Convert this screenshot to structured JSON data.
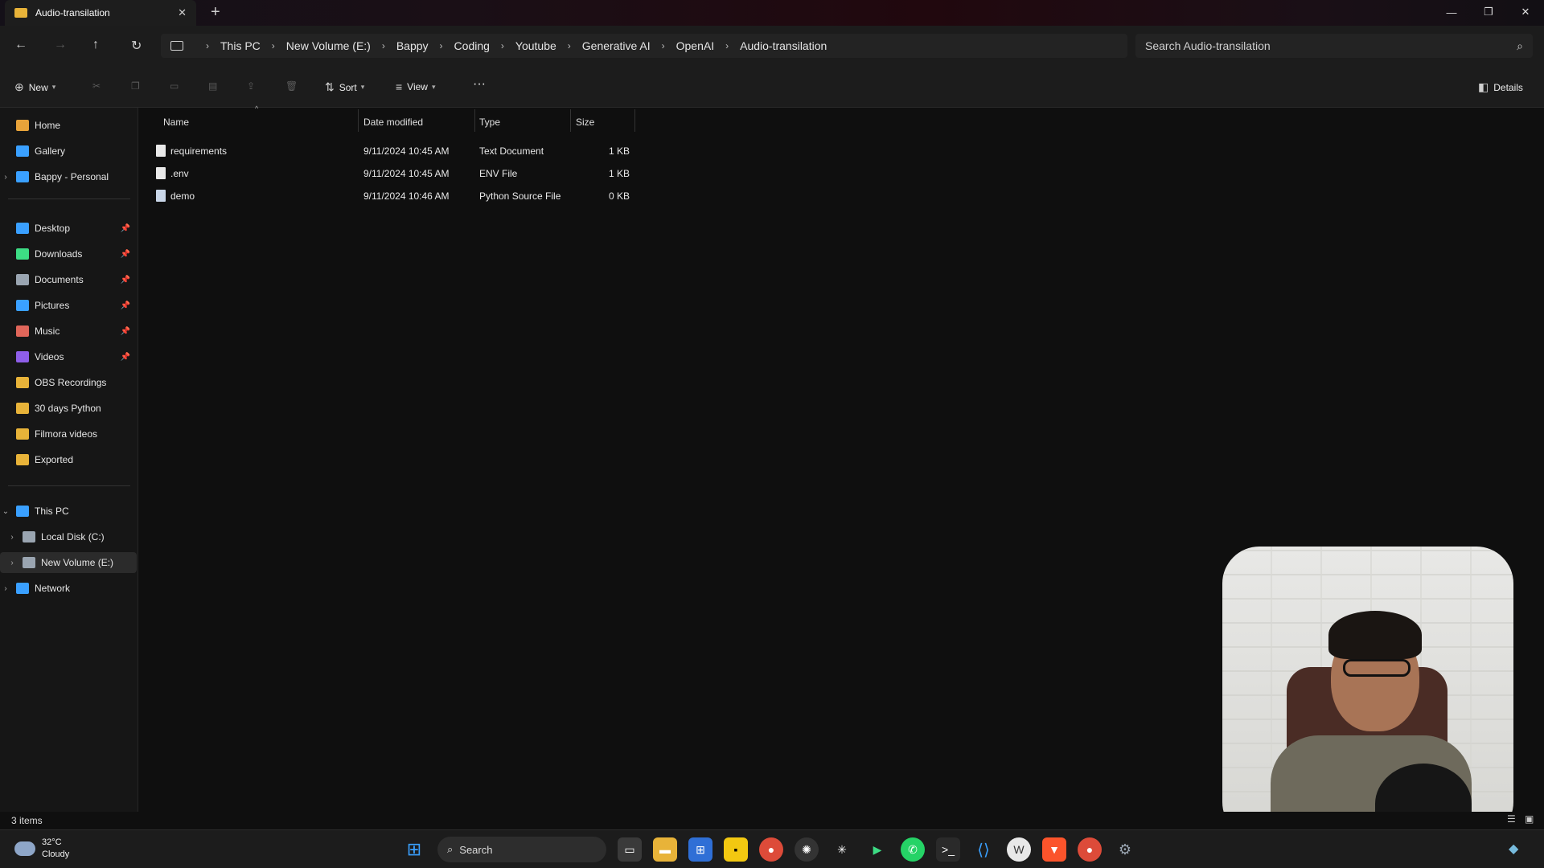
{
  "window": {
    "tab_title": "Audio-transilation",
    "new_tab": "+",
    "minimize": "—",
    "maximize": "❐",
    "close": "✕"
  },
  "address": {
    "crumbs": [
      "This PC",
      "New Volume (E:)",
      "Bappy",
      "Coding",
      "Youtube",
      "Generative AI",
      "OpenAI",
      "Audio-transilation"
    ],
    "search_placeholder": "Search Audio-transilation"
  },
  "toolbar": {
    "new_label": "New",
    "sort_label": "Sort",
    "view_label": "View",
    "more_label": "···",
    "details_label": "Details"
  },
  "sidebar": {
    "quick": [
      {
        "label": "Home",
        "icon": "home-icon"
      },
      {
        "label": "Gallery",
        "icon": "gallery-icon"
      },
      {
        "label": "Bappy - Personal",
        "icon": "cloud-icon"
      }
    ],
    "pinned": [
      {
        "label": "Desktop",
        "icon": "desktop-icon"
      },
      {
        "label": "Downloads",
        "icon": "download-icon"
      },
      {
        "label": "Documents",
        "icon": "document-icon"
      },
      {
        "label": "Pictures",
        "icon": "pictures-icon"
      },
      {
        "label": "Music",
        "icon": "music-icon"
      },
      {
        "label": "Videos",
        "icon": "videos-icon"
      },
      {
        "label": "OBS Recordings",
        "icon": "folder-icon"
      },
      {
        "label": "30 days Python",
        "icon": "folder-icon"
      },
      {
        "label": "Filmora videos",
        "icon": "folder-icon"
      },
      {
        "label": "Exported",
        "icon": "folder-icon"
      }
    ],
    "tree": [
      {
        "label": "This PC",
        "icon": "pc-icon"
      },
      {
        "label": "Local Disk (C:)",
        "icon": "disk-icon"
      },
      {
        "label": "New Volume (E:)",
        "icon": "drive-icon"
      },
      {
        "label": "Network",
        "icon": "network-icon"
      }
    ]
  },
  "columns": [
    "Name",
    "Date modified",
    "Type",
    "Size"
  ],
  "files": [
    {
      "name": "requirements",
      "date": "9/11/2024 10:45 AM",
      "type": "Text Document",
      "size": "1 KB"
    },
    {
      "name": ".env",
      "date": "9/11/2024 10:45 AM",
      "type": "ENV File",
      "size": "1 KB"
    },
    {
      "name": "demo",
      "date": "9/11/2024 10:46 AM",
      "type": "Python Source File",
      "size": "0 KB"
    }
  ],
  "status": {
    "items": "3 items"
  },
  "taskbar": {
    "temp": "32°C",
    "condition": "Cloudy",
    "search": "Search"
  }
}
